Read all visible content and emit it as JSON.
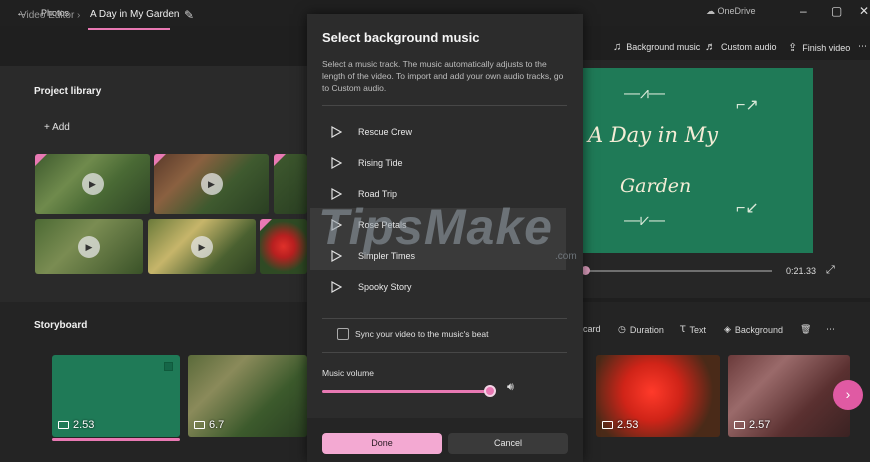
{
  "titlebar": {
    "app_name": "Photos",
    "onedrive": "OneDrive"
  },
  "header": {
    "breadcrumb_parent": "Video Editor",
    "breadcrumb_current": "A Day in My Garden",
    "toolbar": {
      "background_music": "Background music",
      "custom_audio": "Custom audio",
      "finish_video": "Finish video"
    }
  },
  "library": {
    "title": "Project library",
    "add_label": "+ Add"
  },
  "preview": {
    "card_line1": "A Day in My",
    "card_line2": "Garden",
    "time": "0:21.33"
  },
  "storyboard": {
    "title": "Storyboard",
    "tools": {
      "title_card": "card",
      "duration": "Duration",
      "text": "Text",
      "background": "Background"
    },
    "clips": [
      {
        "duration": "2.53",
        "type": "card"
      },
      {
        "duration": "6.7",
        "type": "photo"
      },
      {
        "duration": "2.53",
        "type": "photo"
      },
      {
        "duration": "2.57",
        "type": "photo"
      }
    ]
  },
  "dialog": {
    "title": "Select background music",
    "description": "Select a music track. The music automatically adjusts to the length of the video. To import and add your own audio tracks, go to Custom audio.",
    "tracks": [
      "Rescue Crew",
      "Rising Tide",
      "Road Trip",
      "Rose Petals",
      "Simpler Times",
      "Spooky Story"
    ],
    "sync_label": "Sync your video to the music's beat",
    "volume_label": "Music volume",
    "volume_level": 1.0,
    "done_label": "Done",
    "cancel_label": "Cancel"
  },
  "watermark": {
    "text": "TipsMake",
    "suffix": ".com"
  },
  "colors": {
    "accent": "#e879b3",
    "card_green": "#1f7a57",
    "dialog_bg": "#2c2c2c"
  }
}
